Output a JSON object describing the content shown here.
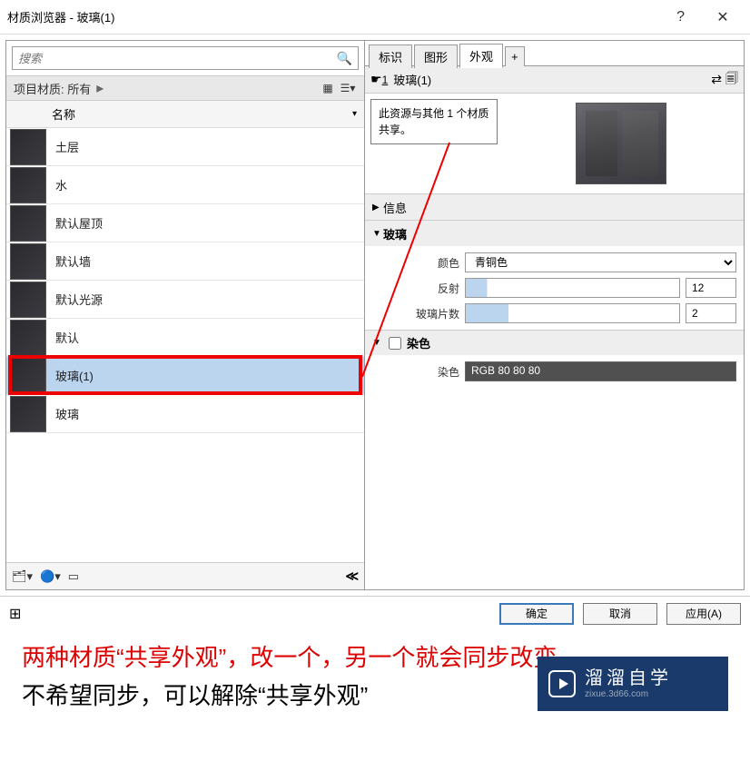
{
  "window": {
    "title": "材质浏览器 - 玻璃(1)"
  },
  "search": {
    "placeholder": "搜索"
  },
  "project_header": {
    "label": "项目材质: 所有"
  },
  "column": {
    "name": "名称"
  },
  "materials": [
    {
      "name": "土层"
    },
    {
      "name": "水"
    },
    {
      "name": "默认屋顶"
    },
    {
      "name": "默认墙"
    },
    {
      "name": "默认光源"
    },
    {
      "name": "默认"
    },
    {
      "name": "玻璃(1)"
    },
    {
      "name": "玻璃"
    }
  ],
  "selected_index": 6,
  "tabs": {
    "identity": "标识",
    "graphics": "图形",
    "appearance": "外观"
  },
  "asset": {
    "index": "1",
    "name": "玻璃(1)"
  },
  "tooltip": "此资源与其他 1 个材质共享。",
  "sections": {
    "info": "信息",
    "glass": {
      "title": "玻璃",
      "color_label": "颜色",
      "color_value": "青铜色",
      "reflect_label": "反射",
      "reflect_value": "12",
      "sheets_label": "玻璃片数",
      "sheets_value": "2"
    },
    "tint": {
      "title": "染色",
      "color_label": "染色",
      "color_value": "RGB 80 80 80"
    }
  },
  "buttons": {
    "ok": "确定",
    "cancel": "取消",
    "apply": "应用(A)"
  },
  "annotation": {
    "line1": "两种材质“共享外观”，改一个，另一个就会同步改变。",
    "line2": "不希望同步，可以解除“共享外观”"
  },
  "logo": {
    "big": "溜溜自学",
    "small": "zixue.3d66.com"
  }
}
